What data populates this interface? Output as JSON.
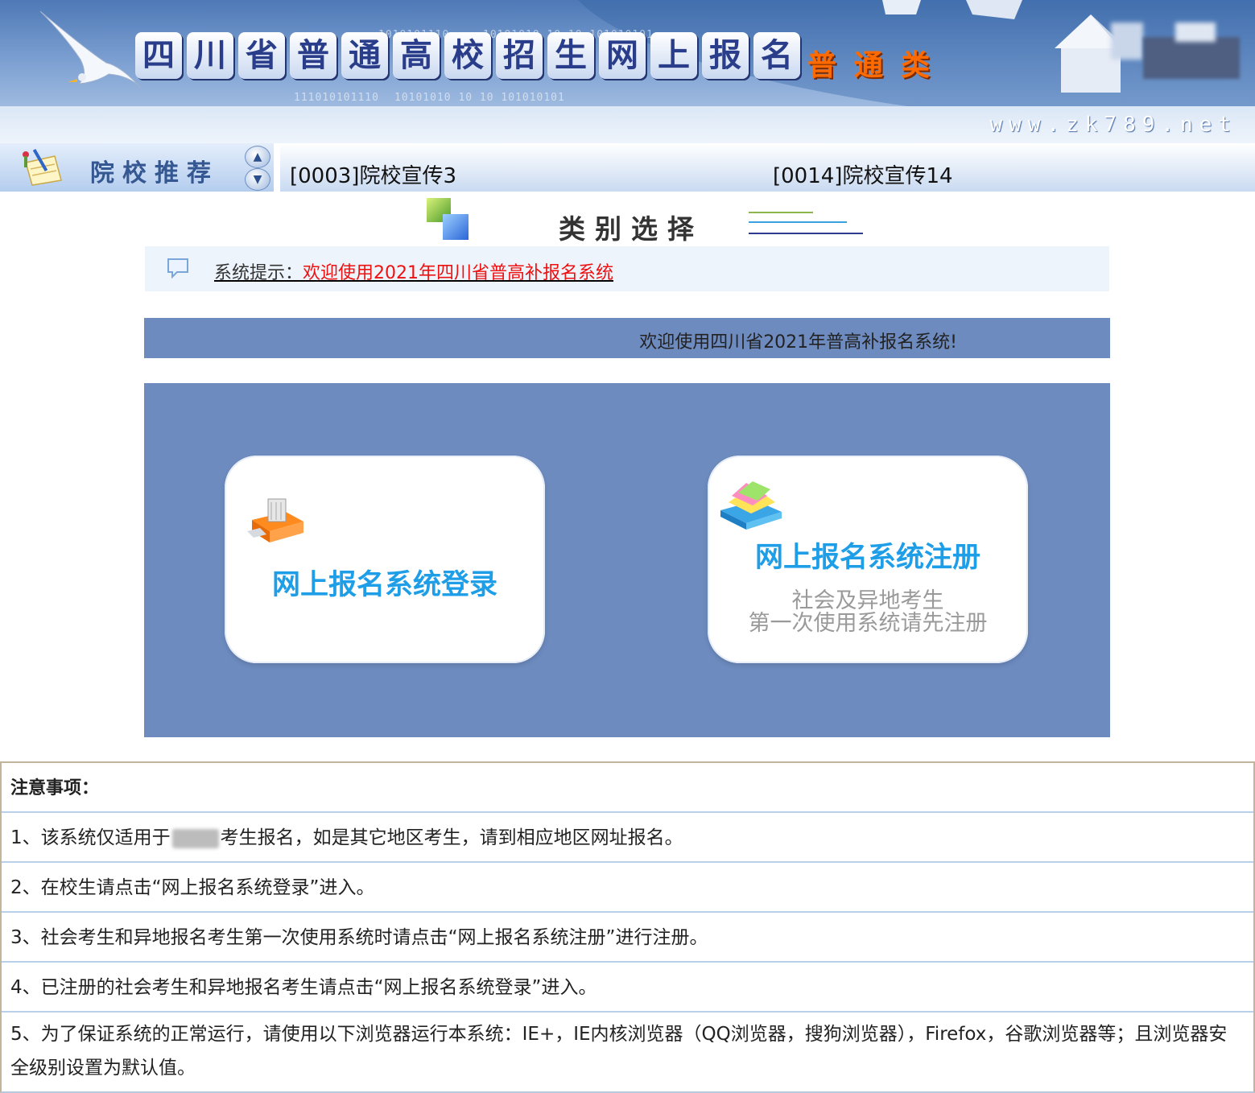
{
  "banner": {
    "title_chars": [
      "四",
      "川",
      "省",
      "普",
      "通",
      "高",
      "校",
      "招",
      "生",
      "网",
      "上",
      "报",
      "名"
    ],
    "subtitle_chars": [
      "普",
      "通",
      "类"
    ],
    "url": "www.zk789.net",
    "binary_text": [
      "1010101110",
      "10101010  10 10 101010101",
      "111010101110",
      "10101010  10 10 101010101"
    ]
  },
  "recommend": {
    "title": "院校推荐",
    "up_arrow": "▲",
    "down_arrow": "▼",
    "links": [
      "[0003]院校宣传3",
      "[0014]院校宣传14"
    ]
  },
  "category": {
    "title": "类别选择"
  },
  "notice": {
    "label": "系统提示：",
    "message": "欢迎使用2021年四川省普高补报名系统"
  },
  "welcome": "欢迎使用四川省2021年普高补报名系统!",
  "cards": {
    "login": {
      "title": "网上报名系统登录"
    },
    "register": {
      "title": "网上报名系统注册",
      "sub1": "社会及异地考生",
      "sub2": "第一次使用系统请先注册"
    }
  },
  "notes": {
    "heading": "注意事项：",
    "item1_a": "1、该系统仅适用于",
    "item1_b": "考生报名，如是其它地区考生，请到相应地区网址报名。",
    "item2": "2、在校生请点击“网上报名系统登录”进入。",
    "item3": "3、社会考生和异地报名考生第一次使用系统时请点击“网上报名系统注册”进行注册。",
    "item4": "4、已注册的社会考生和异地报名考生请点击“网上报名系统登录”进入。",
    "item5": "5、为了保证系统的正常运行，请使用以下浏览器运行本系统：IE+，IE内核浏览器（QQ浏览器，搜狗浏览器），Firefox，谷歌浏览器等；且浏览器安全级别设置为默认值。"
  },
  "colors": {
    "panel": "#6d8bbf",
    "card_title": "#1f9ee8",
    "notice_red": "#ee1111",
    "subtitle_orange": "#ff6a00"
  }
}
